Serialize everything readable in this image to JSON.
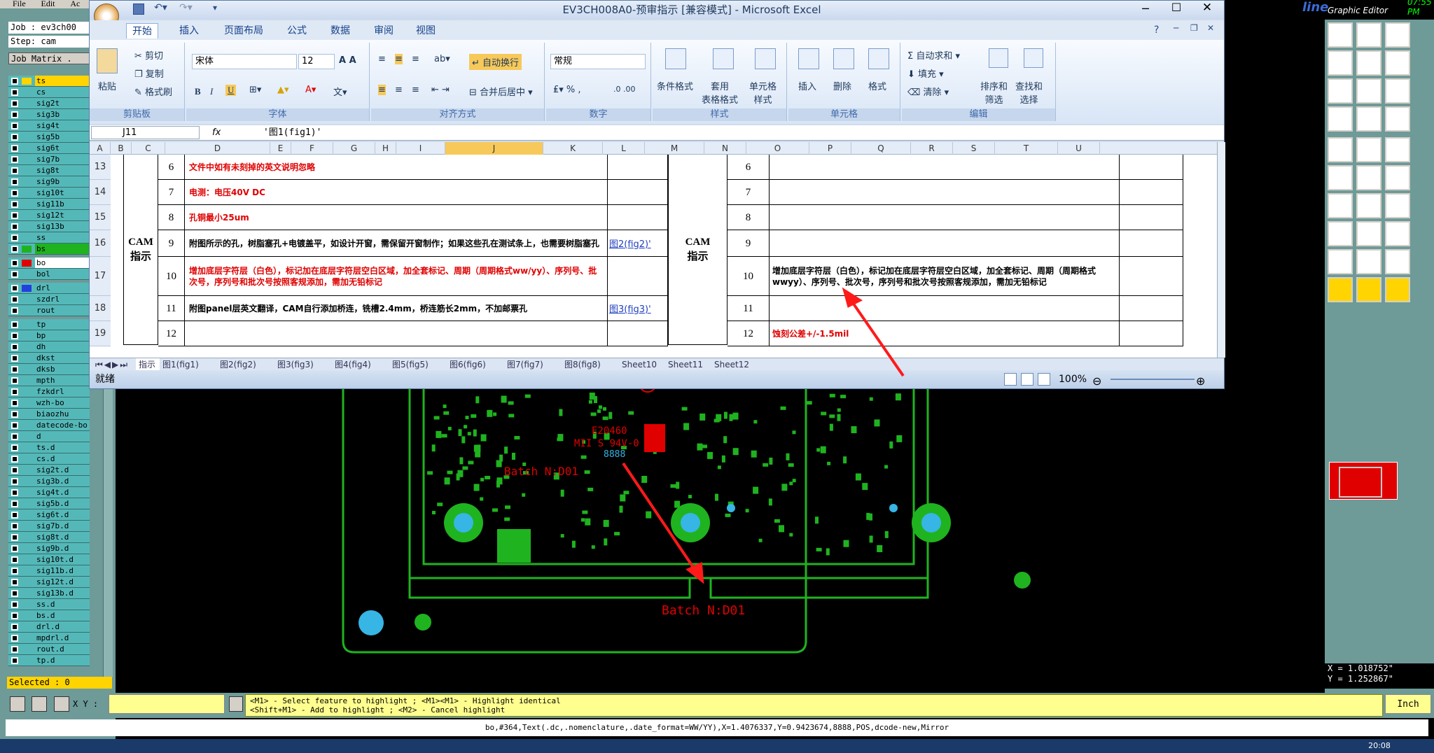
{
  "cad": {
    "menu": [
      "File",
      "Edit",
      "Ac"
    ],
    "job_label": "Job : ev3ch00",
    "step_label": "Step: cam",
    "job_matrix_button": "Job Matrix .",
    "layers": [
      "ts",
      "cs",
      "sig2t",
      "sig3b",
      "sig4t",
      "sig5b",
      "sig6t",
      "sig7b",
      "sig8t",
      "sig9b",
      "sig10t",
      "sig11b",
      "sig12t",
      "sig13b",
      "ss",
      "bs",
      "bo",
      "bol",
      "drl",
      "szdrl",
      "rout",
      "tp",
      "bp",
      "dh",
      "dkst",
      "dksb",
      "mpth",
      "fzkdrl",
      "wzh-bo",
      "biaozhu",
      "datecode-bo",
      "d",
      "ts.d",
      "cs.d",
      "sig2t.d",
      "sig3b.d",
      "sig4t.d",
      "sig5b.d",
      "sig6t.d",
      "sig7b.d",
      "sig8t.d",
      "sig9b.d",
      "sig10t.d",
      "sig11b.d",
      "sig12t.d",
      "sig13b.d",
      "ss.d",
      "bs.d",
      "drl.d",
      "mpdrl.d",
      "rout.d",
      "tp.d"
    ],
    "selected_label": "Selected : 0",
    "graphic_editor_label": "Graphic Editor",
    "clock_top": "07:55 PM",
    "xy_label": "X Y :",
    "xy_value": "",
    "unit_label": "Inch",
    "coord_x": "X = 1.018752\"",
    "coord_y": "Y = 1.252867\"",
    "hint_line1": "<M1> - Select feature to highlight ; <M1><M1> - Highlight identical",
    "hint_line2": "<Shift+M1> - Add to highlight ; <M2> - Cancel highlight",
    "feature_info": "bo,#364,Text(.dc,.nomenclature,.date_format=WW/YY),X=1.4076337,Y=0.9423674,8888,POS,dcode-new,Mirror",
    "board_text_1": "Batch N:D01",
    "board_text_2": "Batch N:D01",
    "board_text_3": "E20460",
    "board_text_4": "MII S 94V-0",
    "board_text_5": "8888",
    "taskbar_clock": "20:08",
    "colors": {
      "panel": "#6e9a98",
      "layer_row": "#55b8b8",
      "highlight_yellow": "#ffd400",
      "board_green": "#1fb31f",
      "board_red": "#e00000",
      "pad_cyan": "#37b5e5"
    }
  },
  "excel": {
    "title": "EV3CH008A0-预审指示 [兼容模式] - Microsoft Excel",
    "tabs": [
      "开始",
      "插入",
      "页面布局",
      "公式",
      "数据",
      "审阅",
      "视图"
    ],
    "ribbon": {
      "clipboard": {
        "label": "剪贴板",
        "paste": "粘贴",
        "cut": "剪切",
        "copy": "复制",
        "format_painter": "格式刷"
      },
      "font": {
        "label": "字体",
        "name": "宋体",
        "size": "12"
      },
      "alignment": {
        "label": "对齐方式",
        "wrap": "自动换行",
        "merge": "合并后居中"
      },
      "number": {
        "label": "数字",
        "format": "常规"
      },
      "styles": {
        "label": "样式",
        "conditional": "条件格式",
        "table": "套用\n表格格式",
        "cell": "单元格\n样式"
      },
      "cells": {
        "label": "单元格",
        "insert": "插入",
        "delete": "删除",
        "format": "格式"
      },
      "editing": {
        "label": "编辑",
        "autosum": "自动求和",
        "fill": "填充",
        "clear": "清除",
        "sort": "排序和\n筛选",
        "find": "查找和\n选择"
      }
    },
    "name_box": "J11",
    "formula": "'图1(fig1)'",
    "fx": "fx",
    "columns": [
      "A",
      "B",
      "C",
      "D",
      "E",
      "F",
      "G",
      "H",
      "I",
      "J",
      "K",
      "L",
      "M",
      "N",
      "O",
      "P",
      "Q",
      "R",
      "S",
      "T",
      "U"
    ],
    "row_numbers": [
      "13",
      "14",
      "15",
      "16",
      "17",
      "18",
      "19"
    ],
    "cam_label": "CAM\n指示",
    "left_rows": [
      {
        "no": "6",
        "text": "文件中如有未刻掉的英文说明忽略",
        "style": "red",
        "link": ""
      },
      {
        "no": "7",
        "text": "电测：电压40V DC",
        "style": "red",
        "link": ""
      },
      {
        "no": "8",
        "text": "孔铜最小25um",
        "style": "red",
        "link": ""
      },
      {
        "no": "9",
        "text": "附图所示的孔，树脂塞孔+电镀盖平，如设计开窗，需保留开窗制作；如果这些孔在测试条上，也需要树脂塞孔",
        "style": "blk",
        "link": "图2(fig2)'"
      },
      {
        "no": "10",
        "text": "增加底层字符层（白色），标记加在底层字符层空白区域，加全套标记、周期（周期格式ww/yy）、序列号、批次号，序列号和批次号按照客规添加，需加无铅标记",
        "style": "red",
        "link": ""
      },
      {
        "no": "11",
        "text": "附图panel层英文翻译，CAM自行添加桥连，铣槽2.4mm，桥连筋长2mm，不加邮票孔",
        "style": "blk",
        "link": "图3(fig3)'"
      },
      {
        "no": "12",
        "text": "",
        "style": "blk",
        "link": ""
      }
    ],
    "right_rows": [
      {
        "no": "6",
        "text": ""
      },
      {
        "no": "7",
        "text": ""
      },
      {
        "no": "8",
        "text": ""
      },
      {
        "no": "9",
        "text": ""
      },
      {
        "no": "10",
        "text": "增加底层字符层（白色），标记加在底层字符层空白区域，加全套标记、周期（周期格式wwyy）、序列号、批次号，序列号和批次号按照客规添加，需加无铅标记"
      },
      {
        "no": "11",
        "text": ""
      },
      {
        "no": "12",
        "text": "蚀刻公差+/-1.5mil"
      }
    ],
    "sheet_tabs": [
      "指示",
      "图1(fig1)",
      "图2(fig2)",
      "图3(fig3)",
      "图4(fig4)",
      "图5(fig5)",
      "图6(fig6)",
      "图7(fig7)",
      "图8(fig8)",
      "Sheet10",
      "Sheet11",
      "Sheet12"
    ],
    "status": "就绪",
    "zoom": "100%"
  }
}
